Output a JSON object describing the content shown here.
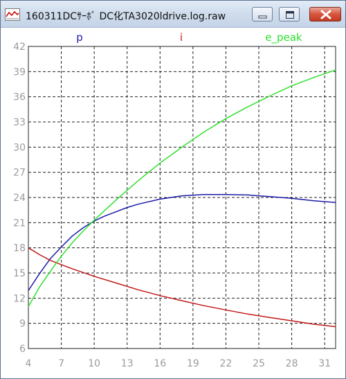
{
  "window": {
    "title": "160311DCｻｰﾎﾞ DC化TA3020ldrive.log.raw",
    "icon": "chart-line-icon",
    "buttons": [
      "minimize",
      "maximize",
      "close"
    ]
  },
  "colors": {
    "p": "#1a1aa6",
    "i": "#c01818",
    "e_peak": "#2ee02e"
  },
  "chart_data": {
    "type": "line",
    "grid": true,
    "x_ticks": [
      4,
      7,
      10,
      13,
      16,
      19,
      22,
      25,
      28,
      31
    ],
    "y_ticks": [
      6,
      9,
      12,
      15,
      18,
      21,
      24,
      27,
      30,
      33,
      36,
      39,
      42
    ],
    "xlim": [
      4,
      32
    ],
    "ylim": [
      6,
      42
    ],
    "series": [
      {
        "name": "p",
        "color": "#1a1aa6",
        "x": [
          4,
          5,
          6,
          7,
          8,
          9,
          10,
          11,
          12,
          13,
          14,
          16,
          18,
          20,
          22,
          24,
          26,
          28,
          30,
          32
        ],
        "y": [
          12.9,
          14.9,
          16.7,
          18.1,
          19.4,
          20.4,
          21.2,
          21.8,
          22.3,
          22.8,
          23.2,
          23.8,
          24.2,
          24.35,
          24.35,
          24.3,
          24.1,
          23.9,
          23.6,
          23.4
        ]
      },
      {
        "name": "i",
        "color": "#c01818",
        "x": [
          4,
          5,
          6,
          7,
          8,
          10,
          12,
          14,
          16,
          18,
          20,
          22,
          24,
          26,
          28,
          30,
          32
        ],
        "y": [
          18.0,
          17.2,
          16.5,
          16.0,
          15.5,
          14.6,
          13.8,
          13.0,
          12.3,
          11.7,
          11.1,
          10.6,
          10.1,
          9.7,
          9.3,
          8.9,
          8.6
        ]
      },
      {
        "name": "e_peak",
        "color": "#2ee02e",
        "x": [
          4,
          5,
          6,
          7,
          8,
          9,
          10,
          12,
          14,
          16,
          18,
          20,
          22,
          24,
          26,
          28,
          30,
          32
        ],
        "y": [
          11.0,
          13.3,
          15.2,
          17.0,
          18.6,
          20.0,
          21.3,
          23.7,
          26.0,
          28.1,
          30.0,
          31.8,
          33.4,
          34.8,
          36.1,
          37.3,
          38.3,
          39.2
        ]
      }
    ]
  }
}
